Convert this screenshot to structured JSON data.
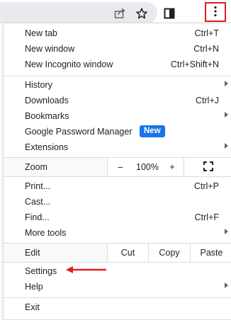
{
  "colors": {
    "highlight_red": "#e11d22",
    "badge_blue": "#1a73e8",
    "separator": "#dadce0"
  },
  "toolbar": {
    "icons": [
      "share-icon",
      "star-icon",
      "side-panel-icon",
      "three-dots-menu-icon"
    ]
  },
  "menu": {
    "group1": [
      {
        "label": "New tab",
        "shortcut": "Ctrl+T"
      },
      {
        "label": "New window",
        "shortcut": "Ctrl+N"
      },
      {
        "label": "New Incognito window",
        "shortcut": "Ctrl+Shift+N"
      }
    ],
    "group2": [
      {
        "label": "History",
        "shortcut": ""
      },
      {
        "label": "Downloads",
        "shortcut": "Ctrl+J"
      },
      {
        "label": "Bookmarks",
        "shortcut": ""
      },
      {
        "label": "Google Password Manager",
        "badge": "New"
      },
      {
        "label": "Extensions",
        "shortcut": ""
      }
    ],
    "zoom": {
      "label": "Zoom",
      "minus": "–",
      "value": "100%",
      "plus": "+"
    },
    "group3": [
      {
        "label": "Print...",
        "shortcut": "Ctrl+P"
      },
      {
        "label": "Cast...",
        "shortcut": ""
      },
      {
        "label": "Find...",
        "shortcut": "Ctrl+F"
      },
      {
        "label": "More tools",
        "shortcut": ""
      }
    ],
    "edit": {
      "label": "Edit",
      "cut": "Cut",
      "copy": "Copy",
      "paste": "Paste"
    },
    "group4": [
      {
        "label": "Settings"
      },
      {
        "label": "Help"
      }
    ],
    "exit": {
      "label": "Exit"
    }
  }
}
